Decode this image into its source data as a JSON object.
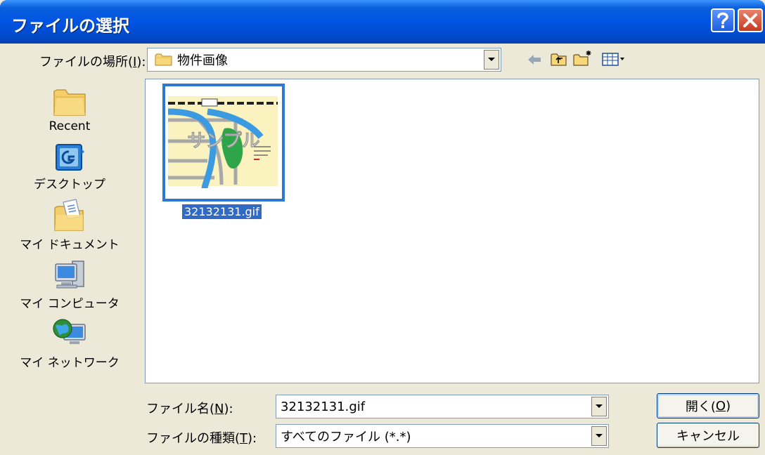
{
  "window": {
    "title": "ファイルの選択",
    "help_icon": "question-mark-icon",
    "close_icon": "close-x-icon"
  },
  "look_in": {
    "label_prefix": "ファイルの場所(",
    "label_key": "I",
    "label_suffix": "):",
    "value": "物件画像",
    "folder_icon": "folder-icon"
  },
  "toolbar": {
    "back_icon": "back-arrow-icon",
    "up_icon": "up-folder-icon",
    "new_folder_icon": "new-folder-icon",
    "view_icon": "view-menu-icon"
  },
  "places": [
    {
      "label": "Recent",
      "icon": "recent-folder-icon"
    },
    {
      "label": "デスクトップ",
      "icon": "desktop-icon"
    },
    {
      "label": "マイ ドキュメント",
      "icon": "my-documents-icon"
    },
    {
      "label": "マイ コンピュータ",
      "icon": "my-computer-icon"
    },
    {
      "label": "マイ ネットワーク",
      "icon": "my-network-icon"
    }
  ],
  "files": [
    {
      "name": "32132131.gif",
      "thumb_watermark": "サンプル",
      "selected": true
    }
  ],
  "filename": {
    "label_prefix": "ファイル名(",
    "label_key": "N",
    "label_suffix": "):",
    "value": "32132131.gif"
  },
  "filetype": {
    "label_prefix": "ファイルの種類(",
    "label_key": "T",
    "label_suffix": "):",
    "value": "すべてのファイル (*.*)"
  },
  "buttons": {
    "open_prefix": "開く(",
    "open_key": "O",
    "open_suffix": ")",
    "cancel": "キャンセル"
  },
  "colors": {
    "title_bar": "#0054E3",
    "selection": "#316AC5",
    "window_bg": "#ECE9D8"
  }
}
